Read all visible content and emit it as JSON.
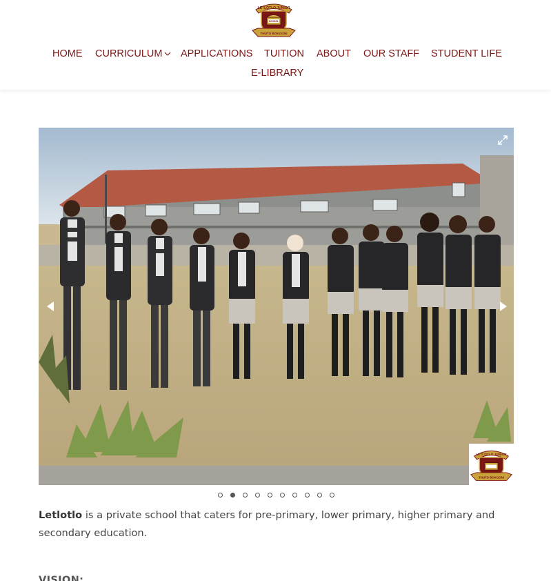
{
  "header": {
    "logo": {
      "banner_text": "LETLOTLO JUNIOR",
      "shield_text": "SCHOOL",
      "ribbon_text": "THUTO BOKGONI"
    },
    "nav": [
      {
        "label": "HOME"
      },
      {
        "label": "CURRICULUM",
        "has_submenu": true
      },
      {
        "label": "APPLICATIONS"
      },
      {
        "label": "TUITION"
      },
      {
        "label": "ABOUT"
      },
      {
        "label": "OUR STAFF"
      },
      {
        "label": "STUDENT LIFE"
      },
      {
        "label": "E-LIBRARY"
      }
    ]
  },
  "slider": {
    "fullscreen_icon": "expand-icon",
    "prev_icon": "triangle-left-icon",
    "next_icon": "triangle-right-icon",
    "slide_count": 10,
    "active_index": 1,
    "watermark": {
      "banner_text": "LETLOTLO JUNIOR",
      "ribbon_text": "THUTO BOKGONI"
    }
  },
  "intro": {
    "school_name": "Letlotlo",
    "text": " is a private school that caters for pre-primary, lower primary, higher primary and secondary education."
  },
  "vision_heading": "VISION:",
  "colors": {
    "brand": "#7a1616",
    "logo_gold": "#c9a23a",
    "text": "#444444"
  }
}
